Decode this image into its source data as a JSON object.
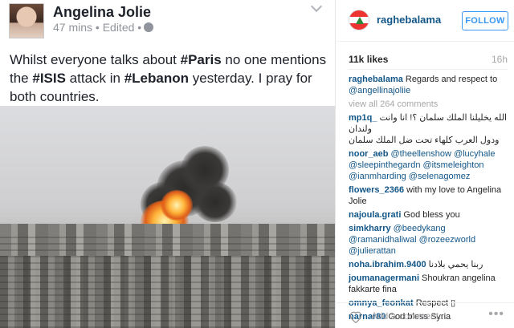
{
  "post_image": {
    "author": "Angelina Jolie",
    "meta": "47 mins • Edited •",
    "text_parts": [
      {
        "t": "Whilst everyone talks about ",
        "b": false
      },
      {
        "t": "#Paris",
        "b": true
      },
      {
        "t": " no one mentions the ",
        "b": false
      },
      {
        "t": "#ISIS",
        "b": true
      },
      {
        "t": " attack in ",
        "b": false
      },
      {
        "t": "#Lebanon",
        "b": true
      },
      {
        "t": " yesterday. I pray for both countries.",
        "b": false
      }
    ]
  },
  "header": {
    "username": "raghebalama",
    "follow_label": "FOLLOW"
  },
  "stats": {
    "likes": "11k likes",
    "time": "16h"
  },
  "comments": {
    "caption": {
      "user": "raghebalama",
      "text": "Regards and respect to",
      "mention": "@angellinajoliie"
    },
    "view_all": "view all 264 comments",
    "items": [
      {
        "user": "mp1q_",
        "text": "الله يخليلنا الملك سلمان ؟! انا وانت ولندان",
        "text2": "ودول العرب كلهاء تحت ضل الملك سلمان",
        "rtl": true
      },
      {
        "user": "noor_aeb",
        "mention": "@theellenshow @lucyhale @sleepinthegardn @itsmeleighton @ianmharding @selenagomez"
      },
      {
        "user": "flowers_2366",
        "text": "with my love to Angelina Jolie"
      },
      {
        "user": "najoula.grati",
        "text": "God bless you"
      },
      {
        "user": "simkharry",
        "mention": "@beedykang @ramanidhaliwal @rozeezworld @julierattan"
      },
      {
        "user": "noha.ibrahim.9400",
        "text": "ربنا يحمي بلادنا",
        "rtl": true
      },
      {
        "user": "joumanagermani",
        "text": "Shoukran angelina fakkarte fina"
      },
      {
        "user": "omnya_feonkat",
        "text": "Respect ▯"
      },
      {
        "user": "narnar80",
        "text": "God bless Syria"
      }
    ]
  },
  "footer": {
    "add_placeholder": "Add a comment...",
    "more": "•••"
  },
  "colors": {
    "link": "#125688",
    "follow": "#3897f0",
    "muted": "#a5a7aa"
  }
}
